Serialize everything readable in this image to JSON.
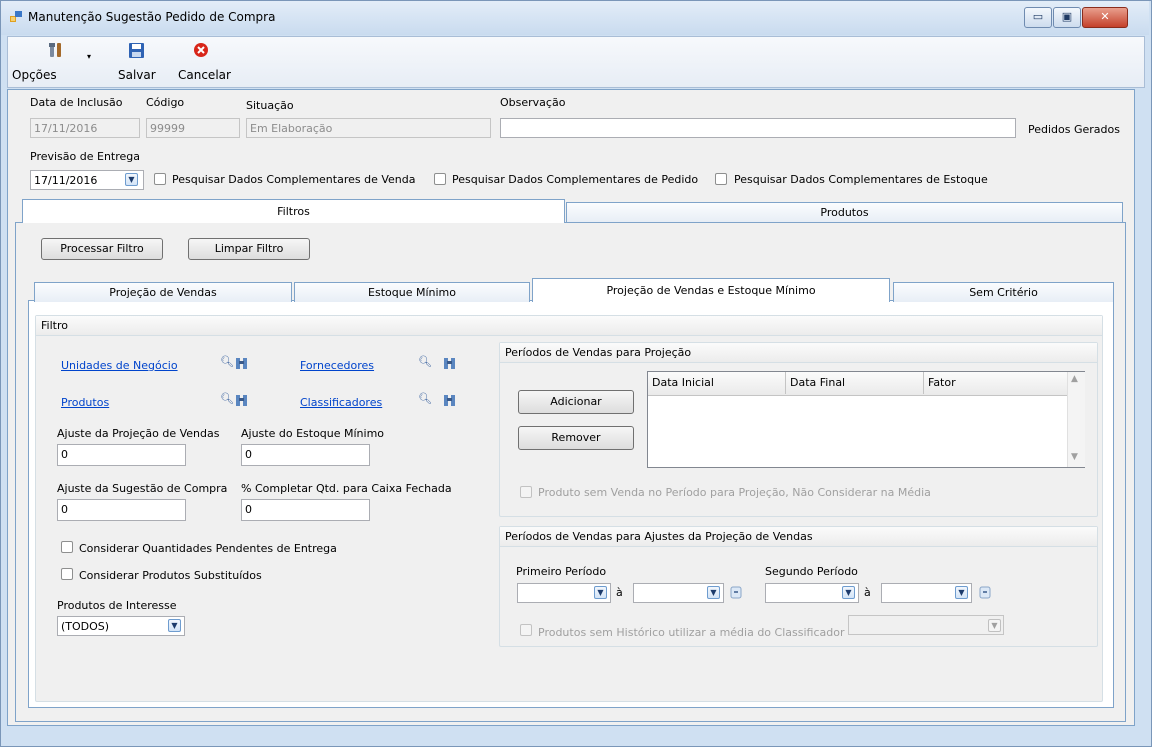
{
  "window": {
    "title": "Manutenção Sugestão Pedido de Compra",
    "min": "▭",
    "max": "▣",
    "close": "✕"
  },
  "toolbar": {
    "options_label": "Opções",
    "save_label": "Salvar",
    "cancel_label": "Cancelar"
  },
  "header": {
    "data_inclusao_label": "Data de Inclusão",
    "data_inclusao_value": "17/11/2016",
    "codigo_label": "Código",
    "codigo_value": "99999",
    "situacao_label": "Situação",
    "situacao_value": "Em Elaboração",
    "observacao_label": "Observação",
    "observacao_value": "",
    "pedidos_gerados_label": "Pedidos Gerados",
    "previsao_label": "Previsão de Entrega",
    "previsao_value": "17/11/2016",
    "chk_venda_label": "Pesquisar Dados Complementares de Venda",
    "chk_pedido_label": "Pesquisar Dados Complementares de Pedido",
    "chk_estoque_label": "Pesquisar Dados Complementares de Estoque"
  },
  "tabs": {
    "filtros": "Filtros",
    "produtos": "Produtos"
  },
  "filter_buttons": {
    "processar": "Processar Filtro",
    "limpar": "Limpar Filtro"
  },
  "subtabs": {
    "projecao": "Projeção de Vendas",
    "estoque": "Estoque Mínimo",
    "projecao_estoque": "Projeção de Vendas e Estoque Mínimo",
    "sem_criterio": "Sem Critério"
  },
  "filtro": {
    "title": "Filtro",
    "unidades_link": "Unidades de Negócio",
    "fornecedores_link": "Fornecedores",
    "produtos_link": "Produtos",
    "classificadores_link": "Classificadores",
    "ajuste_proj_label": "Ajuste da Projeção de Vendas",
    "ajuste_proj_value": "0",
    "ajuste_estoque_label": "Ajuste do Estoque Mínimo",
    "ajuste_estoque_value": "0",
    "ajuste_sug_label": "Ajuste da Sugestão de Compra",
    "ajuste_sug_value": "0",
    "completar_label": "% Completar Qtd. para Caixa Fechada",
    "completar_value": "0",
    "chk_pendentes_label": "Considerar Quantidades Pendentes de Entrega",
    "chk_substituidos_label": "Considerar Produtos Substituídos",
    "interesse_label": "Produtos de Interesse",
    "interesse_value": "(TODOS)"
  },
  "periodos_projecao": {
    "title": "Períodos de Vendas para Projeção",
    "adicionar": "Adicionar",
    "remover": "Remover",
    "columns": [
      "Data Inicial",
      "Data Final",
      "Fator"
    ],
    "chk_label": "Produto sem Venda no Período para Projeção, Não Considerar na Média"
  },
  "periodos_ajustes": {
    "title": "Períodos de Vendas para Ajustes da Projeção de Vendas",
    "primeiro_label": "Primeiro Período",
    "segundo_label": "Segundo Período",
    "a1": "à",
    "a2": "à",
    "chk_label": "Produtos sem Histórico utilizar a média do Classificador"
  }
}
